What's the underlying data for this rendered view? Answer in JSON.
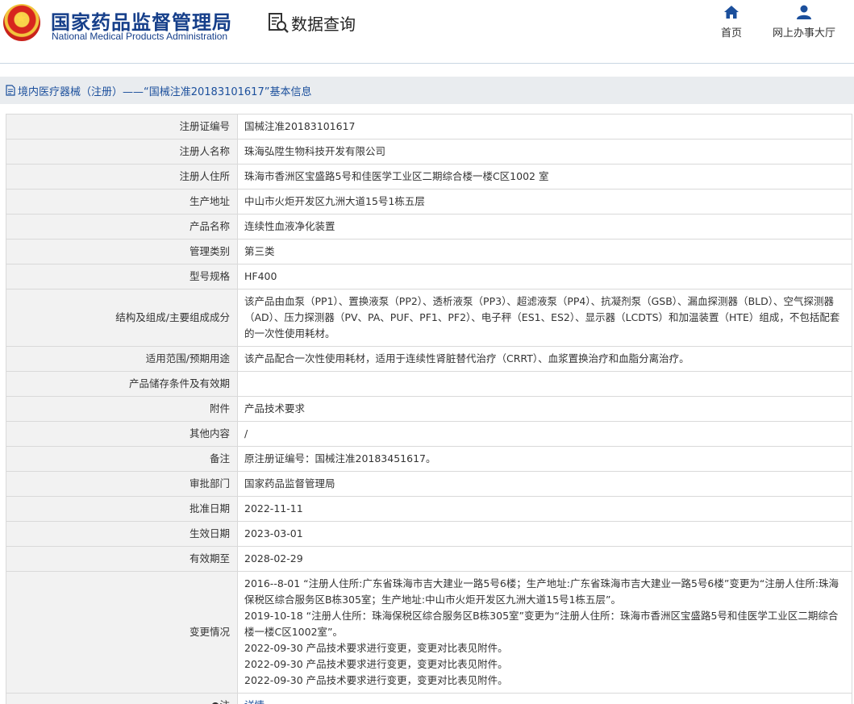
{
  "header": {
    "org_cn": "国家药品监督管理局",
    "org_en": "National Medical Products Administration",
    "data_query": "数据查询",
    "nav": [
      {
        "label": "首页",
        "icon": "home-icon"
      },
      {
        "label": "网上办事大厅",
        "icon": "user-icon"
      }
    ]
  },
  "titlebar": {
    "text": "境内医疗器械（注册）——“国械注准20183101617”基本信息"
  },
  "colors": {
    "brand": "#163f8a",
    "link": "#1b4f9c",
    "label_bg": "#f2f2f2",
    "titlebar_bg": "#e9ecef"
  },
  "rows": [
    {
      "key": "注册证编号",
      "value": "国械注准20183101617"
    },
    {
      "key": "注册人名称",
      "value": "珠海弘陞生物科技开发有限公司"
    },
    {
      "key": "注册人住所",
      "value": "珠海市香洲区宝盛路5号和佳医学工业区二期综合楼一楼C区1002 室"
    },
    {
      "key": "生产地址",
      "value": "中山市火炬开发区九洲大道15号1栋五层"
    },
    {
      "key": "产品名称",
      "value": "连续性血液净化装置"
    },
    {
      "key": "管理类别",
      "value": "第三类"
    },
    {
      "key": "型号规格",
      "value": "HF400"
    },
    {
      "key": "结构及组成/主要组成成分",
      "value": "该产品由血泵（PP1）、置换液泵（PP2）、透析液泵（PP3）、超滤液泵（PP4）、抗凝剂泵（GSB）、漏血探测器（BLD）、空气探测器（AD）、压力探测器（PV、PA、PUF、PF1、PF2）、电子秤（ES1、ES2）、显示器（LCDTS）和加温装置（HTE）组成，不包括配套的一次性使用耗材。"
    },
    {
      "key": "适用范围/预期用途",
      "value": "该产品配合一次性使用耗材，适用于连续性肾脏替代治疗（CRRT）、血浆置换治疗和血脂分离治疗。"
    },
    {
      "key": "产品储存条件及有效期",
      "value": ""
    },
    {
      "key": "附件",
      "value": "产品技术要求"
    },
    {
      "key": "其他内容",
      "value": "/"
    },
    {
      "key": "备注",
      "value": "原注册证编号：国械注准20183451617。"
    },
    {
      "key": "审批部门",
      "value": "国家药品监督管理局"
    },
    {
      "key": "批准日期",
      "value": "2022-11-11"
    },
    {
      "key": "生效日期",
      "value": "2023-03-01"
    },
    {
      "key": "有效期至",
      "value": "2028-02-29"
    }
  ],
  "changes": {
    "key": "变更情况",
    "lines": [
      "2016--8-01 “注册人住所:广东省珠海市吉大建业一路5号6楼；生产地址:广东省珠海市吉大建业一路5号6楼”变更为“注册人住所:珠海保税区综合服务区B栋305室；生产地址:中山市火炬开发区九洲大道15号1栋五层”。",
      "2019-10-18 “注册人住所：珠海保税区综合服务区B栋305室”变更为“注册人住所：珠海市香洲区宝盛路5号和佳医学工业区二期综合楼一楼C区1002室”。",
      "2022-09-30 产品技术要求进行变更，变更对比表见附件。",
      "2022-09-30 产品技术要求进行变更，变更对比表见附件。",
      "2022-09-30 产品技术要求进行变更，变更对比表见附件。"
    ]
  },
  "last_row": {
    "key": "●注",
    "value": "详情"
  }
}
